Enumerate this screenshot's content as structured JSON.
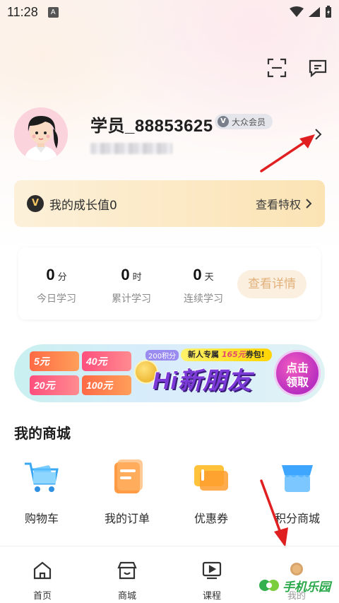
{
  "status_bar": {
    "time": "11:28",
    "indicator": "A"
  },
  "header": {
    "icons": [
      "scan-icon",
      "message-icon"
    ]
  },
  "profile": {
    "username": "学员_88853625",
    "member_badge": "大众会员",
    "badge_icon": "V"
  },
  "growth": {
    "icon": "V",
    "label": "我的成长值0",
    "link": "查看特权"
  },
  "stats": {
    "items": [
      {
        "value": "0",
        "unit": "分",
        "label": "今日学习"
      },
      {
        "value": "0",
        "unit": "时",
        "label": "累计学习"
      },
      {
        "value": "0",
        "unit": "天",
        "label": "连续学习"
      }
    ],
    "detail_button": "查看详情"
  },
  "banner": {
    "coupons": [
      "5元",
      "40元",
      "20元",
      "100元"
    ],
    "points_tag": "200积分",
    "tag_prefix": "新人专属",
    "tag_amount": "165元",
    "tag_suffix": "券包!",
    "title": "Hi新朋友",
    "button": "点击领取"
  },
  "mall": {
    "title": "我的商城",
    "items": [
      {
        "label": "购物车",
        "icon": "cart-icon"
      },
      {
        "label": "我的订单",
        "icon": "order-icon"
      },
      {
        "label": "优惠券",
        "icon": "coupon-icon"
      },
      {
        "label": "积分商城",
        "icon": "points-mall-icon"
      }
    ]
  },
  "tabbar": {
    "items": [
      {
        "label": "首页",
        "icon": "home-icon"
      },
      {
        "label": "商城",
        "icon": "store-icon"
      },
      {
        "label": "课程",
        "icon": "video-icon"
      },
      {
        "label": "我的",
        "icon": "profile-icon"
      }
    ]
  },
  "watermark": "手机乐园",
  "colors": {
    "accent_orange": "#e2b07a",
    "growth_bg": "#fbe3b4",
    "annotation_red": "#e02020"
  }
}
